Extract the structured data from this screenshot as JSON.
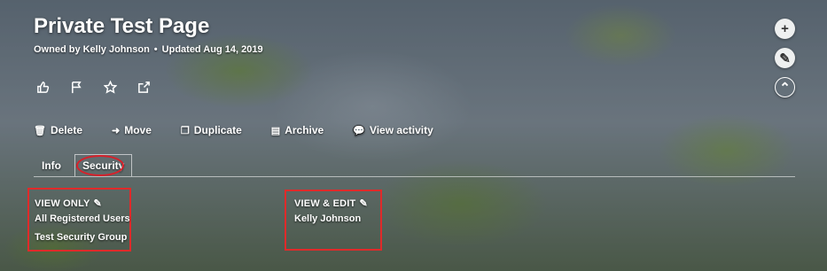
{
  "page": {
    "title": "Private Test Page",
    "owner_text": "Owned by Kelly Johnson",
    "updated_text": "Updated Aug 14, 2019",
    "separator": "•"
  },
  "social_icons": [
    "thumbs-up-icon",
    "flag-icon",
    "star-icon",
    "share-icon"
  ],
  "side_actions": [
    {
      "name": "add-icon",
      "glyph": "+"
    },
    {
      "name": "edit-icon",
      "glyph": "✎"
    },
    {
      "name": "collapse-icon",
      "glyph": "⌃"
    }
  ],
  "toolbar": {
    "delete": {
      "label": "Delete",
      "icon": "trash-icon"
    },
    "move": {
      "label": "Move",
      "icon": "arrow-circle-icon"
    },
    "duplicate": {
      "label": "Duplicate",
      "icon": "copy-icon"
    },
    "archive": {
      "label": "Archive",
      "icon": "archive-icon"
    },
    "activity": {
      "label": "View activity",
      "icon": "comments-icon"
    }
  },
  "tabs": {
    "info": "Info",
    "security": "Security",
    "active": "security"
  },
  "security": {
    "view_only": {
      "title": "VIEW ONLY",
      "entries": [
        "All Registered Users",
        "Test Security Group"
      ]
    },
    "view_edit": {
      "title": "VIEW & EDIT",
      "entries": [
        "Kelly Johnson"
      ]
    }
  },
  "colors": {
    "highlight_red": "#e02a2a",
    "text": "#ffffff"
  }
}
